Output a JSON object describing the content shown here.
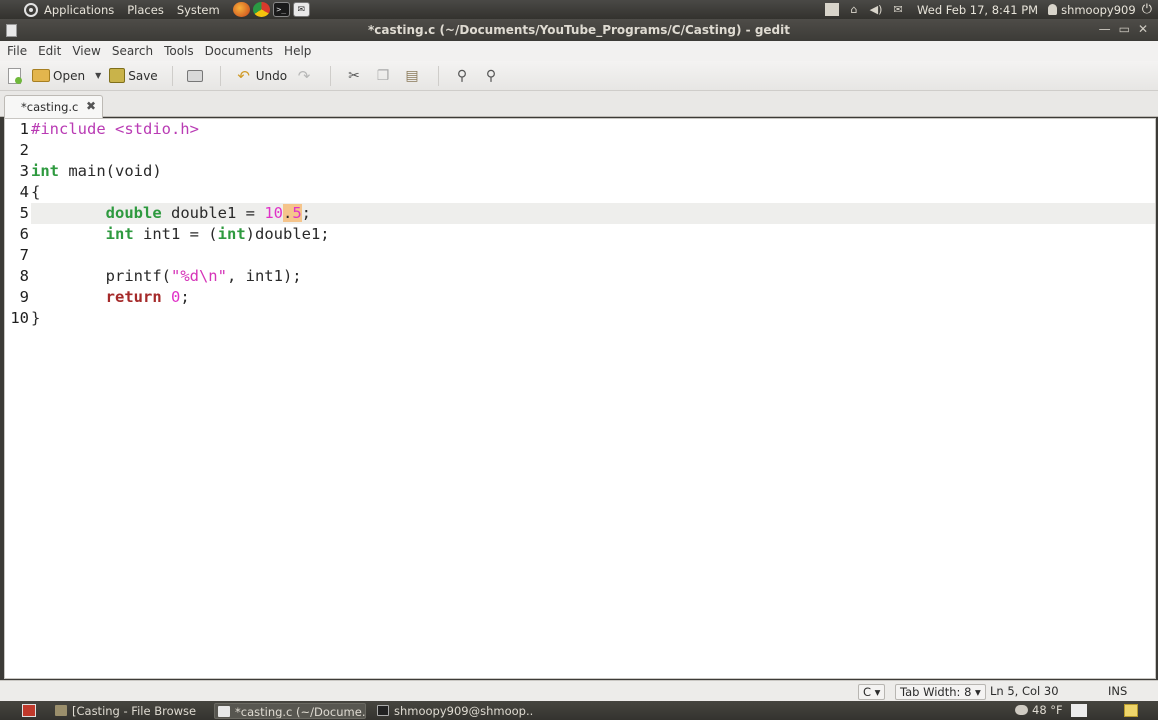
{
  "top_panel": {
    "menus": [
      "Applications",
      "Places",
      "System"
    ],
    "clock": "Wed Feb 17,  8:41 PM",
    "user": "shmoopy909"
  },
  "window": {
    "title": "*casting.c (~/Documents/YouTube_Programs/C/Casting) - gedit"
  },
  "menubar": [
    "File",
    "Edit",
    "View",
    "Search",
    "Tools",
    "Documents",
    "Help"
  ],
  "toolbar": {
    "open_label": "Open",
    "save_label": "Save",
    "undo_label": "Undo"
  },
  "tab": {
    "label": "*casting.c"
  },
  "editor": {
    "line_numbers": [
      "1",
      "2",
      "3",
      "4",
      "5",
      "6",
      "7",
      "8",
      "9",
      "10"
    ],
    "current_line": 5
  },
  "statusbar": {
    "language": "C",
    "tab_width": "Tab Width:  8",
    "position": "Ln 5, Col 30",
    "mode": "INS"
  },
  "bottom_panel": {
    "tasks": [
      "[Casting - File Browser]",
      "*casting.c (~/Docume...",
      "shmoopy909@shmoop..."
    ],
    "weather": "48 °F"
  },
  "colors": {
    "keyword": "#2e9a3f",
    "preprocessor": "#b93bb4",
    "number": "#e031c8",
    "return_keyword": "#a52a2a",
    "bracket_highlight": "#f5c48b"
  }
}
